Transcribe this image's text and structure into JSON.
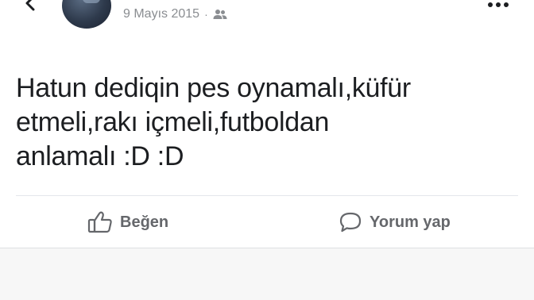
{
  "post": {
    "date": "9 Mayıs 2015",
    "separator": "·",
    "audience_icon": "friends-icon",
    "text": "Hatun dediqin pes oynamalı,küfür\netmeli,rakı içmeli,futboldan\nanlamalı :D :D"
  },
  "header": {
    "back_icon": "back-chevron-icon",
    "more_icon": "more-options-icon"
  },
  "actions": {
    "like_label": "Beğen",
    "like_icon": "thumbs-up-icon",
    "comment_label": "Yorum yap",
    "comment_icon": "comment-bubble-icon"
  },
  "colors": {
    "text": "#1c1e21",
    "meta": "#8a8d91",
    "action": "#65676b",
    "divider": "#e4e6eb"
  }
}
